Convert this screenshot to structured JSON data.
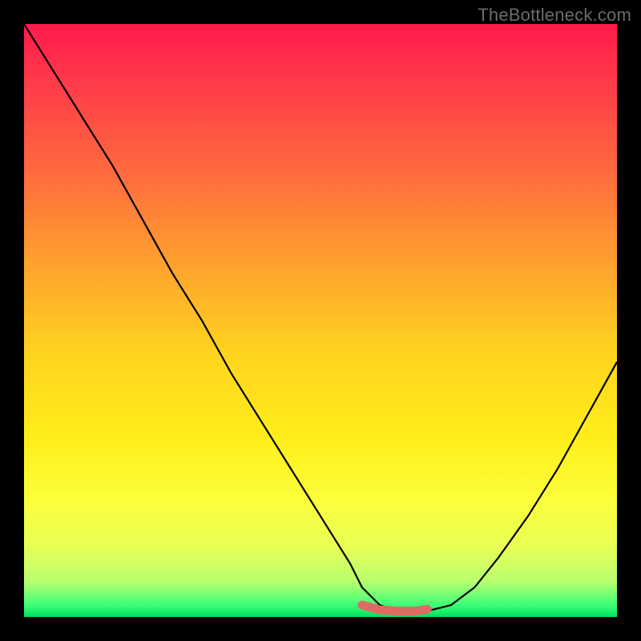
{
  "watermark": "TheBottleneck.com",
  "chart_data": {
    "type": "line",
    "title": "",
    "xlabel": "",
    "ylabel": "",
    "xlim": [
      0,
      100
    ],
    "ylim": [
      0,
      100
    ],
    "grid": false,
    "legend": false,
    "series": [
      {
        "name": "bottleneck-curve",
        "x": [
          0,
          5,
          10,
          15,
          20,
          25,
          30,
          35,
          40,
          45,
          50,
          55,
          57,
          60,
          63,
          66,
          68,
          72,
          76,
          80,
          85,
          90,
          95,
          100
        ],
        "values": [
          100,
          92,
          84,
          76,
          67,
          58,
          50,
          41,
          33,
          25,
          17,
          9,
          5,
          2,
          1,
          1,
          1,
          2,
          5,
          10,
          17,
          25,
          34,
          43
        ]
      },
      {
        "name": "optimal-marker",
        "x": [
          57,
          60,
          63,
          66,
          68
        ],
        "values": [
          2,
          1.2,
          1,
          1,
          1.3
        ]
      }
    ],
    "colors": {
      "curve": "#000000",
      "marker": "#de6a63"
    }
  }
}
